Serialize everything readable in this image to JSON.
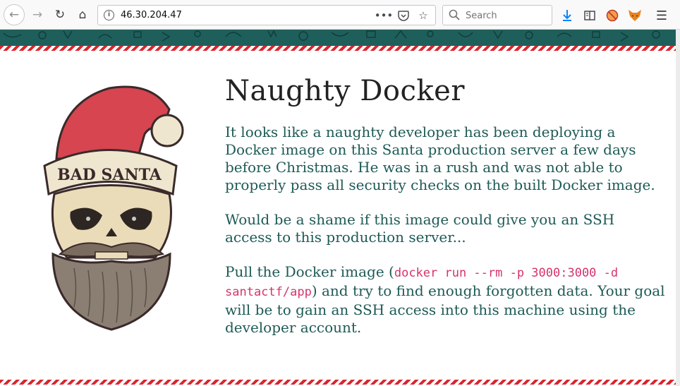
{
  "browser": {
    "url": "46.30.204.47",
    "search_placeholder": "Search",
    "icons": [
      "back-icon",
      "forward-icon",
      "reload-icon",
      "home-icon",
      "info-icon",
      "more-icon",
      "pocket-icon",
      "star-icon",
      "search-icon",
      "download-icon",
      "reader-view-icon",
      "blocked-extension-icon",
      "fox-extension-icon",
      "menu-icon"
    ]
  },
  "page": {
    "title": "Naughty Docker",
    "paragraph1": "It looks like a naughty developer has been deploying a Docker image on this Santa production server a few days before Christmas. He was in a rush and was not able to properly pass all security checks on the built Docker image.",
    "paragraph2": "Would be a shame if this image could give you an SSH access to this production server...",
    "paragraph3_before": "Pull the Docker image (",
    "paragraph3_code": "docker run --rm -p 3000:3000 -d santactf/app",
    "paragraph3_after": ") and try to find enough forgotten data. Your goal will be to gain an SSH access into this machine using the developer account.",
    "logo_text": "BAD SANTA"
  },
  "colors": {
    "header_band": "#1f5f5b",
    "text": "#1d5a56",
    "code": "#d6336c",
    "stripe_red": "#d9262c"
  }
}
